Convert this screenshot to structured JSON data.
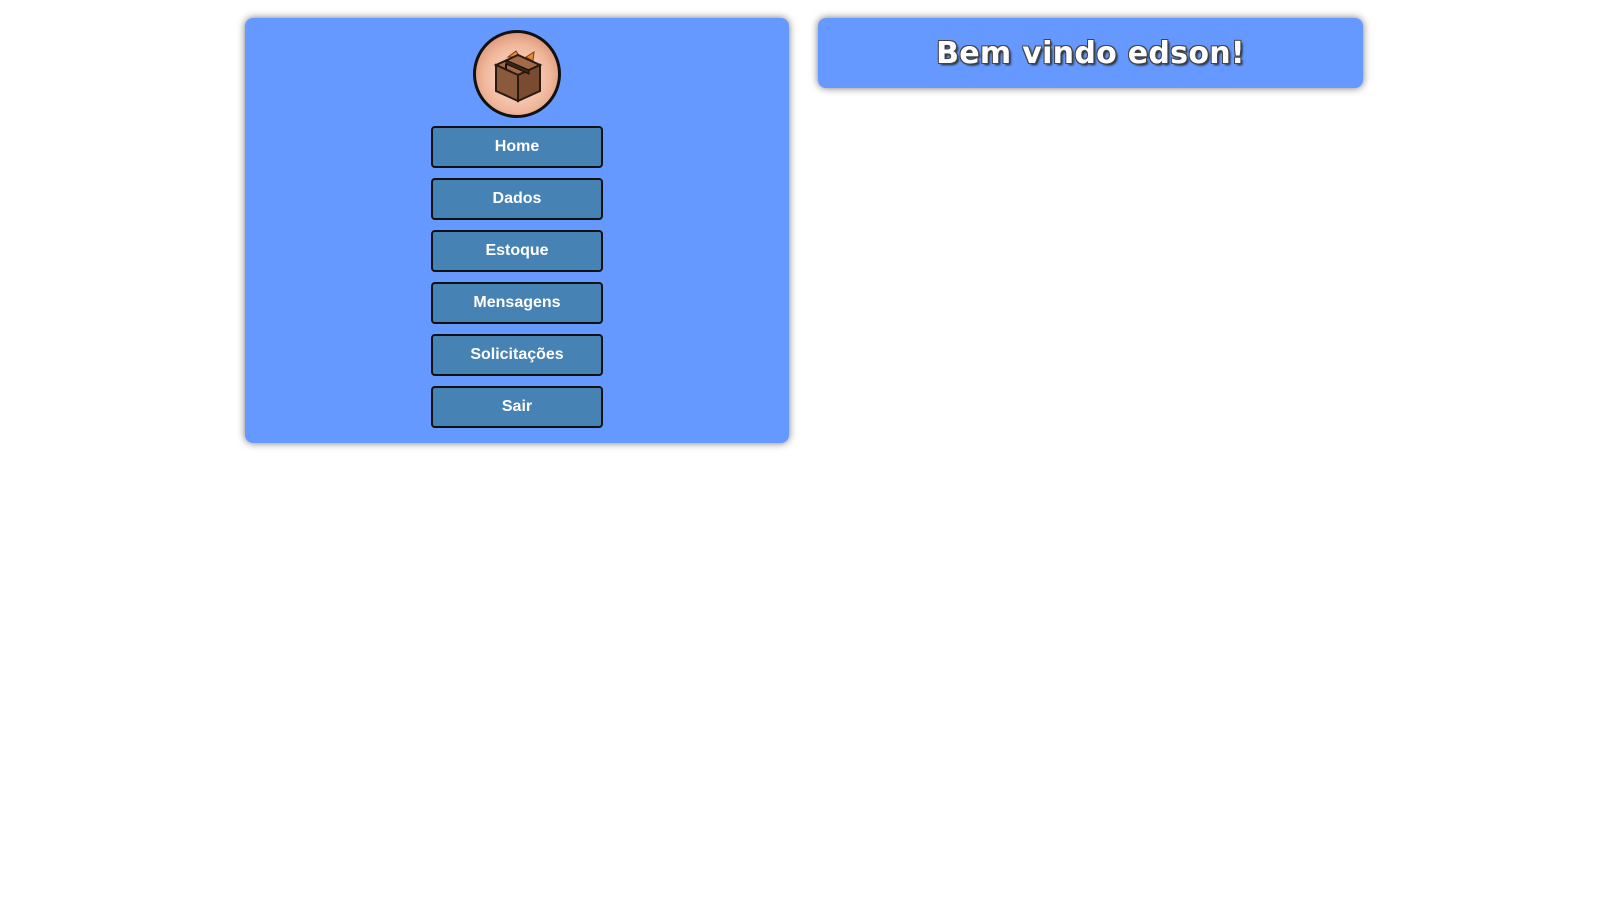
{
  "sidebar": {
    "logo_icon": "cardboard-box-icon",
    "items": [
      {
        "label": "Home"
      },
      {
        "label": "Dados"
      },
      {
        "label": "Estoque"
      },
      {
        "label": "Mensagens"
      },
      {
        "label": "Solicitações"
      },
      {
        "label": "Sair"
      }
    ]
  },
  "header": {
    "welcome": "Bem vindo edson!"
  },
  "colors": {
    "panel": "#6699ff",
    "button": "#4682b4",
    "page_background": "#ffffff"
  }
}
